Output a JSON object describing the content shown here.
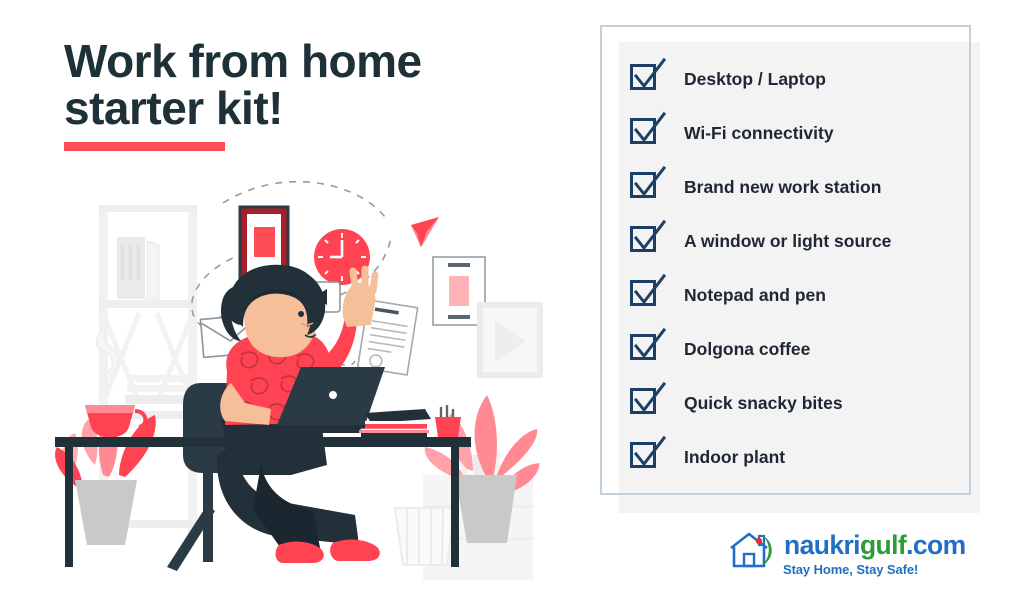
{
  "heading": {
    "line1": "Work from home",
    "line2": "starter kit!",
    "text": "Work from home\nstarter kit!",
    "accent_color": "#ff4d58",
    "text_color": "#1e3038"
  },
  "checklist": {
    "frame_border_color": "#c3d0de",
    "panel_color": "#f3f3f3",
    "checkbox_color": "#1c3f66",
    "items": [
      {
        "label": "Desktop / Laptop",
        "checked": true
      },
      {
        "label": "Wi-Fi connectivity",
        "checked": true
      },
      {
        "label": "Brand new work station",
        "checked": true
      },
      {
        "label": "A window or light source",
        "checked": true
      },
      {
        "label": "Notepad and pen",
        "checked": true
      },
      {
        "label": "Dolgona coffee",
        "checked": true
      },
      {
        "label": "Quick snacky bites",
        "checked": true
      },
      {
        "label": "Indoor plant",
        "checked": true
      }
    ]
  },
  "logo": {
    "word_naukri": "naukri",
    "word_gulf": "gulf",
    "word_com": ".com",
    "tagline": "Stay Home, Stay Safe!",
    "blue": "#1f6fc4",
    "green": "#2e9b33",
    "dot_red": "#e4322b"
  },
  "illustration": {
    "description": "Woman working on a laptop at a desk at home",
    "palette": {
      "red": "#ff4d58",
      "light_red": "#ff8a92",
      "dark": "#22303a",
      "navy": "#2b3b45",
      "gray": "#d8d8d8",
      "light_gray": "#efefef",
      "skin": "#f6bf9a"
    },
    "objects": [
      "bookshelf",
      "framed-picture",
      "wall-clock",
      "envelope",
      "paper-plane",
      "tablet",
      "media-button",
      "document",
      "laptop",
      "coffee-cup",
      "book-stack",
      "pen-holder",
      "desk",
      "chair",
      "waste-basket",
      "potted-plant-left",
      "potted-plant-right"
    ]
  }
}
